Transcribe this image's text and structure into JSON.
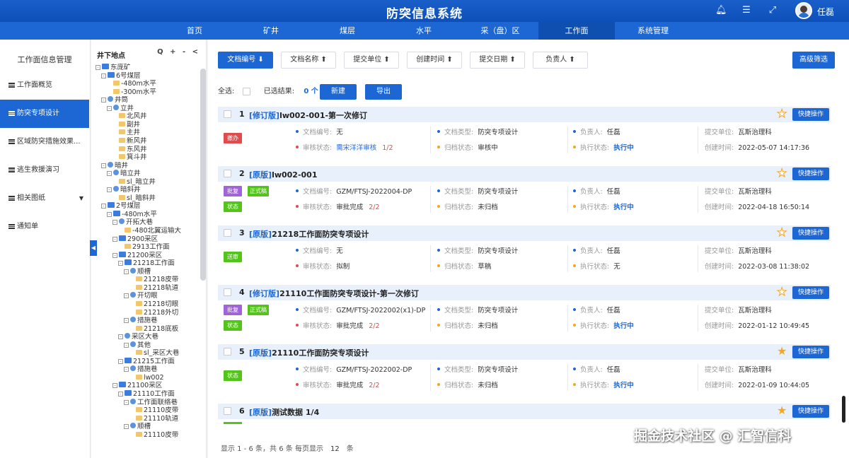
{
  "app": {
    "title": "防突信息系统",
    "user": "任磊"
  },
  "header_icons": [
    "bell-icon",
    "list-icon",
    "fullscreen-icon"
  ],
  "nav": [
    "首页",
    "矿井",
    "煤层",
    "水平",
    "采（盘）区",
    "工作面",
    "系统管理"
  ],
  "nav_active": 5,
  "left_menu": {
    "title": "工作面信息管理",
    "items": [
      "工作面概览",
      "防突专项设计",
      "区域防突措施效果...",
      "逃生救援演习",
      "相关图纸",
      "通知单"
    ],
    "active": 1
  },
  "tree": {
    "title": "井下地点",
    "tools": "Q + - <",
    "nodes": [
      {
        "label": "东庞矿",
        "level": 0,
        "type": "house",
        "toggle": "-"
      },
      {
        "label": "6号煤层",
        "level": 1,
        "type": "home",
        "toggle": "-"
      },
      {
        "label": "-480m水平",
        "level": 2,
        "type": "folder",
        "toggle": ""
      },
      {
        "label": "-300m水平",
        "level": 2,
        "type": "folder",
        "toggle": ""
      },
      {
        "label": "井筒",
        "level": 1,
        "type": "globe",
        "toggle": "-"
      },
      {
        "label": "立井",
        "level": 2,
        "type": "globe",
        "toggle": "-"
      },
      {
        "label": "北风井",
        "level": 3,
        "type": "folder",
        "toggle": ""
      },
      {
        "label": "副井",
        "level": 3,
        "type": "folder",
        "toggle": ""
      },
      {
        "label": "主井",
        "level": 3,
        "type": "folder",
        "toggle": ""
      },
      {
        "label": "新风井",
        "level": 3,
        "type": "folder",
        "toggle": ""
      },
      {
        "label": "东风井",
        "level": 3,
        "type": "folder",
        "toggle": ""
      },
      {
        "label": "箕斗井",
        "level": 3,
        "type": "folder",
        "toggle": ""
      },
      {
        "label": "暗井",
        "level": 1,
        "type": "globe",
        "toggle": "-"
      },
      {
        "label": "暗立井",
        "level": 2,
        "type": "globe",
        "toggle": "-"
      },
      {
        "label": "sl_暗立井",
        "level": 3,
        "type": "folder",
        "toggle": ""
      },
      {
        "label": "暗斜井",
        "level": 2,
        "type": "globe",
        "toggle": "-"
      },
      {
        "label": "sl_暗斜井",
        "level": 3,
        "type": "folder",
        "toggle": ""
      },
      {
        "label": "2号煤层",
        "level": 1,
        "type": "home",
        "toggle": "-"
      },
      {
        "label": "-480m水平",
        "level": 2,
        "type": "house",
        "toggle": "-"
      },
      {
        "label": "开拓大巷",
        "level": 3,
        "type": "globe",
        "toggle": "-"
      },
      {
        "label": "-480北翼运输大",
        "level": 4,
        "type": "folder",
        "toggle": ""
      },
      {
        "label": "2900采区",
        "level": 3,
        "type": "house",
        "toggle": "-"
      },
      {
        "label": "2913工作面",
        "level": 4,
        "type": "folder",
        "toggle": ""
      },
      {
        "label": "21200采区",
        "level": 3,
        "type": "house",
        "toggle": "-"
      },
      {
        "label": "21218工作面",
        "level": 4,
        "type": "house",
        "toggle": "-"
      },
      {
        "label": "顺槽",
        "level": 5,
        "type": "globe",
        "toggle": "-"
      },
      {
        "label": "21218皮带",
        "level": 6,
        "type": "folder",
        "toggle": ""
      },
      {
        "label": "21218轨道",
        "level": 6,
        "type": "folder",
        "toggle": ""
      },
      {
        "label": "开切眼",
        "level": 5,
        "type": "globe",
        "toggle": "-"
      },
      {
        "label": "21218切眼",
        "level": 6,
        "type": "folder",
        "toggle": ""
      },
      {
        "label": "21218外切",
        "level": 6,
        "type": "folder",
        "toggle": ""
      },
      {
        "label": "措施巷",
        "level": 5,
        "type": "globe",
        "toggle": "-"
      },
      {
        "label": "21218底板",
        "level": 6,
        "type": "folder",
        "toggle": ""
      },
      {
        "label": "采区大巷",
        "level": 4,
        "type": "globe",
        "toggle": "-"
      },
      {
        "label": "其他",
        "level": 5,
        "type": "globe",
        "toggle": "-"
      },
      {
        "label": "sl_采区大巷",
        "level": 6,
        "type": "folder",
        "toggle": ""
      },
      {
        "label": "21215工作面",
        "level": 4,
        "type": "house",
        "toggle": "-"
      },
      {
        "label": "措施巷",
        "level": 5,
        "type": "globe",
        "toggle": "-"
      },
      {
        "label": "lw002",
        "level": 6,
        "type": "folder",
        "toggle": ""
      },
      {
        "label": "21100采区",
        "level": 3,
        "type": "house",
        "toggle": "-"
      },
      {
        "label": "21110工作面",
        "level": 4,
        "type": "house",
        "toggle": "-"
      },
      {
        "label": "工作面联络巷",
        "level": 5,
        "type": "globe",
        "toggle": "-"
      },
      {
        "label": "21110皮带",
        "level": 6,
        "type": "folder",
        "toggle": ""
      },
      {
        "label": "21110轨道",
        "level": 6,
        "type": "folder",
        "toggle": ""
      },
      {
        "label": "顺槽",
        "level": 5,
        "type": "globe",
        "toggle": "-"
      },
      {
        "label": "21110皮带",
        "level": 6,
        "type": "folder",
        "toggle": ""
      }
    ]
  },
  "sort_buttons": [
    "文档编号 ⬇",
    "文档名称 ⬆",
    "提交单位 ⬆",
    "创建时间 ⬆",
    "提交日期 ⬆",
    "负责人 ⬆"
  ],
  "adv_filter": "高级筛选",
  "selection": {
    "all_label": "全选:",
    "selected_label": "已选结果:",
    "count": "0 个",
    "new_btn": "新建",
    "export_btn": "导出"
  },
  "labels": {
    "doc_no": "文档编号:",
    "review": "审核状态:",
    "doc_type": "文档类型:",
    "archive": "归档状态:",
    "owner": "负责人:",
    "exec": "执行状态:",
    "unit": "提交单位:",
    "created": "创建时间:",
    "quick": "快捷操作"
  },
  "cards": [
    {
      "no": "1",
      "ver": "[修订版]",
      "name": "lw002-001-第一次修订",
      "starred": false,
      "tags": [
        {
          "text": "撤办",
          "color": "red"
        }
      ],
      "doc_no": "无",
      "review": "需宋洋洋审核",
      "review_link": true,
      "review_count": "1/2",
      "doc_type": "防突专项设计",
      "archive": "审核中",
      "owner": "任磊",
      "exec": "执行中",
      "exec_bold": true,
      "unit": "瓦斯治理科",
      "created": "2022-05-07 14:17:36"
    },
    {
      "no": "2",
      "ver": "[原版]",
      "name": "lw002-001",
      "starred": false,
      "tags": [
        {
          "text": "批复",
          "color": "purple"
        },
        {
          "text": "正式稿",
          "color": "green"
        },
        {
          "text": "状态",
          "color": "green"
        }
      ],
      "doc_no": "GZM/FTSJ-2022004-DP",
      "review": "审批完成",
      "review_link": false,
      "review_count": "2/2",
      "doc_type": "防突专项设计",
      "archive": "未归档",
      "owner": "任磊",
      "exec": "执行中",
      "exec_bold": true,
      "unit": "瓦斯治理科",
      "created": "2022-04-18 16:50:14"
    },
    {
      "no": "3",
      "ver": "[原版]",
      "name": "21218工作面防突专项设计",
      "starred": false,
      "tags": [
        {
          "text": "送审",
          "color": "green"
        }
      ],
      "doc_no": "无",
      "review": "拟制",
      "review_link": false,
      "review_count": "",
      "doc_type": "防突专项设计",
      "archive": "草稿",
      "owner": "任磊",
      "exec": "无",
      "exec_bold": false,
      "unit": "瓦斯治理科",
      "created": "2022-03-08 11:38:02"
    },
    {
      "no": "4",
      "ver": "[修订版]",
      "name": "21110工作面防突专项设计-第一次修订",
      "starred": false,
      "tags": [
        {
          "text": "批复",
          "color": "purple"
        },
        {
          "text": "正式稿",
          "color": "green"
        },
        {
          "text": "状态",
          "color": "green"
        }
      ],
      "doc_no": "GZM/FTSJ-2022002(x1)-DP",
      "review": "审批完成",
      "review_link": false,
      "review_count": "2/2",
      "doc_type": "防突专项设计",
      "archive": "未归档",
      "owner": "任磊",
      "exec": "执行中",
      "exec_bold": true,
      "unit": "瓦斯治理科",
      "created": "2022-01-12 10:49:45"
    },
    {
      "no": "5",
      "ver": "[原版]",
      "name": "21110工作面防突专项设计",
      "starred": true,
      "tags": [
        {
          "text": "状态",
          "color": "green"
        }
      ],
      "doc_no": "GZM/FTSJ-2022002-DP",
      "review": "审批完成",
      "review_link": false,
      "review_count": "2/2",
      "doc_type": "防突专项设计",
      "archive": "未归档",
      "owner": "任磊",
      "exec": "执行中",
      "exec_bold": true,
      "unit": "瓦斯治理科",
      "created": "2022-01-09 10:44:05"
    },
    {
      "no": "6",
      "ver": "[原版]",
      "name": "测试数据 1/4",
      "starred": true,
      "tags": [],
      "partial": true
    }
  ],
  "footer": {
    "text": "显示 1 - 6 条，共 6 条 每页显示",
    "page_size": "12",
    "unit": "条"
  },
  "watermark": "掘金技术社区 @ 汇智信科",
  "colors": {
    "primary": "#1d67d4",
    "header": "#1a5fc9",
    "star": "#f5a623",
    "red_tag": "#e24b4b",
    "purple_tag": "#a163d8",
    "green_tag": "#52c41a"
  }
}
